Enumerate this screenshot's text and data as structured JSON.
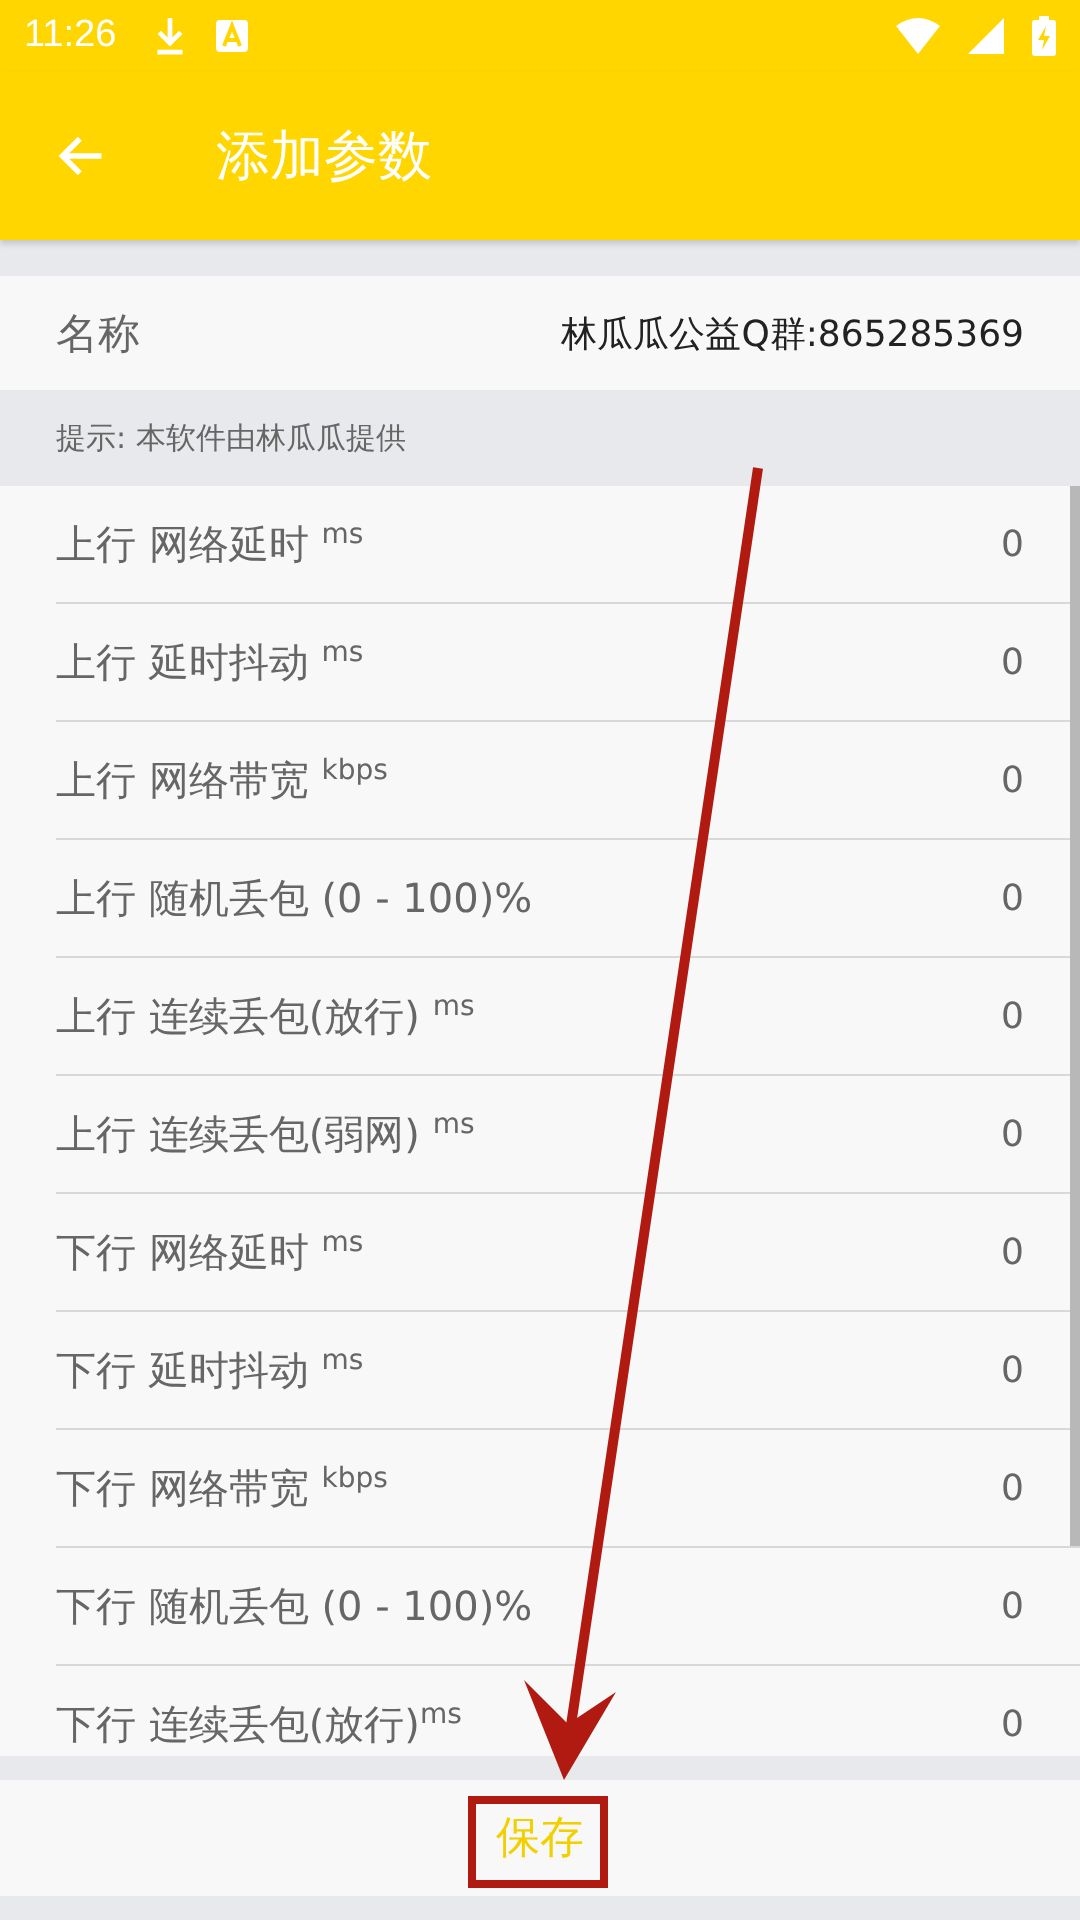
{
  "status_bar": {
    "time": "11:26"
  },
  "app_bar": {
    "title": "添加参数"
  },
  "name_row": {
    "label": "名称",
    "value": "林瓜瓜公益Q群:865285369"
  },
  "hint": "提示: 本软件由林瓜瓜提供",
  "params": [
    {
      "label": "上行 网络延时 $^{ms}$",
      "value": "0"
    },
    {
      "label": "上行 延时抖动 $^{ms}$",
      "value": "0"
    },
    {
      "label": "上行 网络带宽 $^{kbps}$",
      "value": "0"
    },
    {
      "label": "上行 随机丢包 (0 - 100)%",
      "value": "0"
    },
    {
      "label": "上行 连续丢包(放行) $^{ms}$",
      "value": "0"
    },
    {
      "label": "上行 连续丢包(弱网) $^{ms}$",
      "value": "0"
    },
    {
      "label": "下行 网络延时 $^{ms}$",
      "value": "0"
    },
    {
      "label": "下行 延时抖动 $^{ms}$",
      "value": "0"
    },
    {
      "label": "下行 网络带宽 $^{kbps}$",
      "value": "0"
    },
    {
      "label": "下行 随机丢包 (0 - 100)%",
      "value": "0"
    },
    {
      "label": "下行 连续丢包(放行)$^{ms}$",
      "value": "0"
    }
  ],
  "save_button": "保存"
}
